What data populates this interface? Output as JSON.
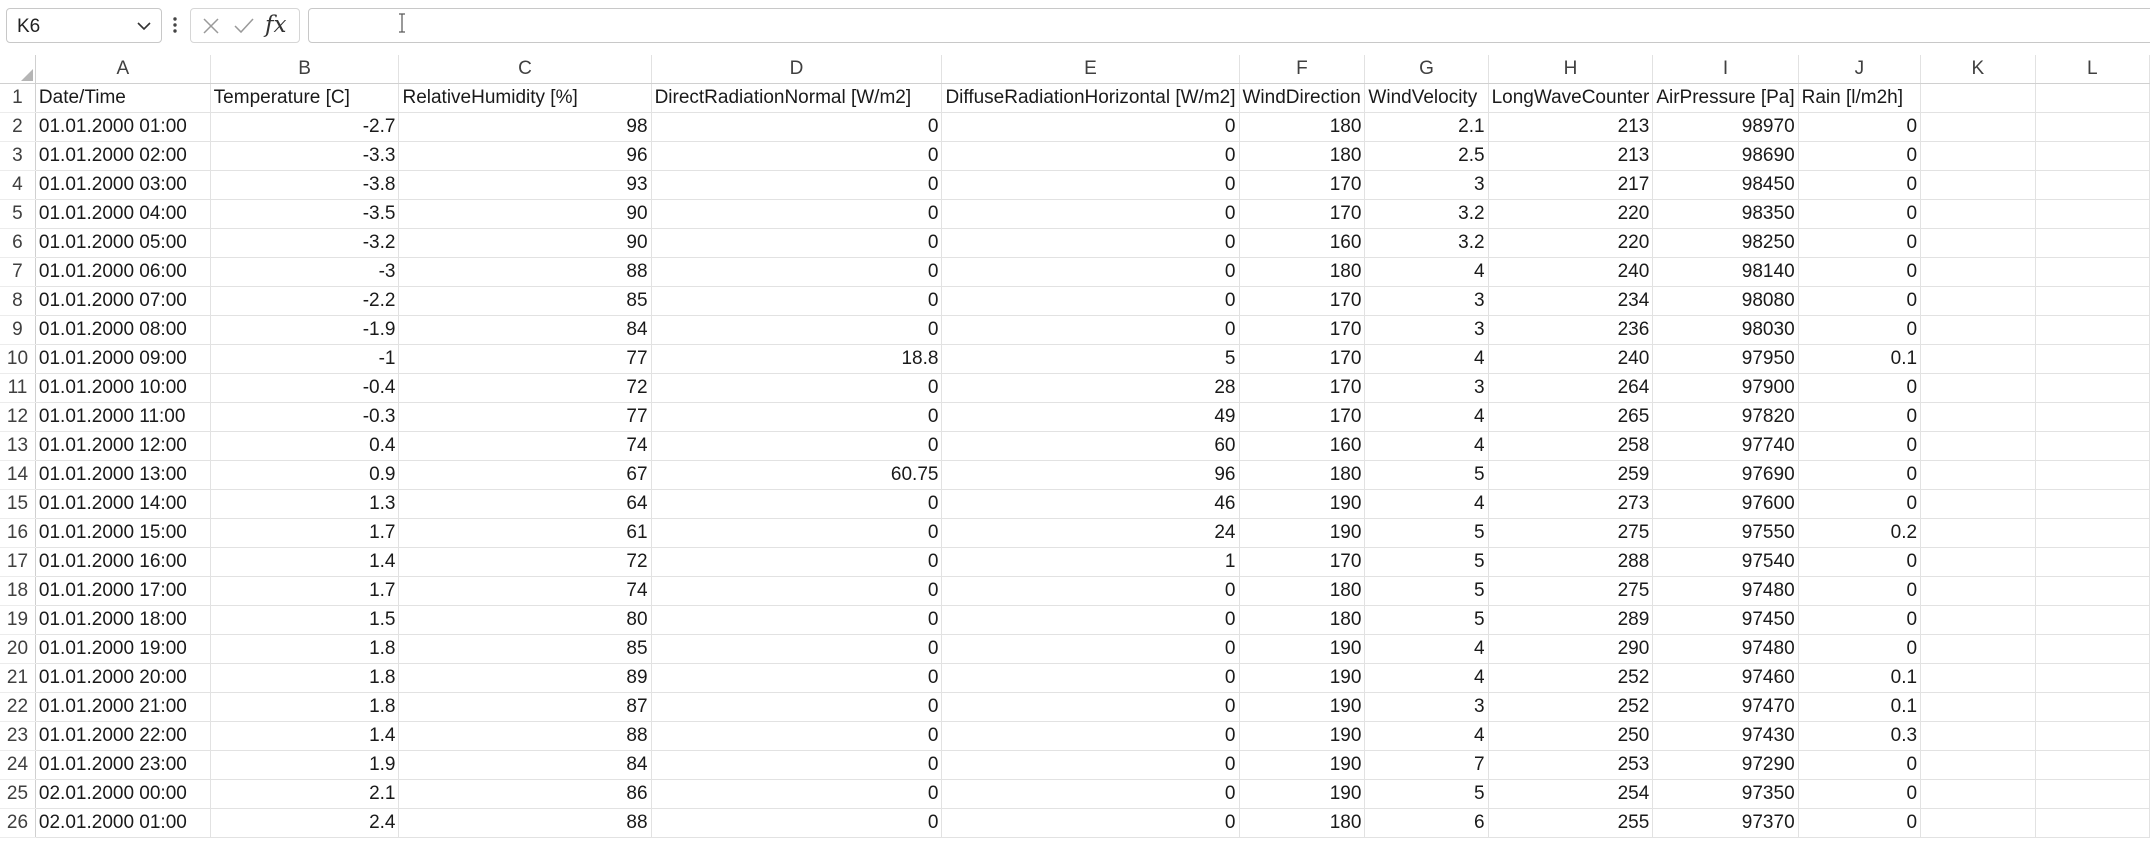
{
  "formula_bar": {
    "name_box": "K6",
    "formula_value": "",
    "fx_label": "fx"
  },
  "columns": [
    "A",
    "B",
    "C",
    "D",
    "E",
    "F",
    "G",
    "H",
    "I",
    "J",
    "K",
    "L"
  ],
  "headers": [
    "Date/Time",
    "Temperature [C]",
    "RelativeHumidity [%]",
    "DirectRadiationNormal [W/m2]",
    "DiffuseRadiationHorizontal [W/m2]",
    "WindDirection",
    "WindVelocity",
    "LongWaveCounter",
    "AirPressure [Pa]",
    "Rain [l/m2h]",
    "",
    ""
  ],
  "rows": [
    [
      "01.01.2000 01:00",
      "-2.7",
      "98",
      "0",
      "0",
      "180",
      "2.1",
      "213",
      "98970",
      "0"
    ],
    [
      "01.01.2000 02:00",
      "-3.3",
      "96",
      "0",
      "0",
      "180",
      "2.5",
      "213",
      "98690",
      "0"
    ],
    [
      "01.01.2000 03:00",
      "-3.8",
      "93",
      "0",
      "0",
      "170",
      "3",
      "217",
      "98450",
      "0"
    ],
    [
      "01.01.2000 04:00",
      "-3.5",
      "90",
      "0",
      "0",
      "170",
      "3.2",
      "220",
      "98350",
      "0"
    ],
    [
      "01.01.2000 05:00",
      "-3.2",
      "90",
      "0",
      "0",
      "160",
      "3.2",
      "220",
      "98250",
      "0"
    ],
    [
      "01.01.2000 06:00",
      "-3",
      "88",
      "0",
      "0",
      "180",
      "4",
      "240",
      "98140",
      "0"
    ],
    [
      "01.01.2000 07:00",
      "-2.2",
      "85",
      "0",
      "0",
      "170",
      "3",
      "234",
      "98080",
      "0"
    ],
    [
      "01.01.2000 08:00",
      "-1.9",
      "84",
      "0",
      "0",
      "170",
      "3",
      "236",
      "98030",
      "0"
    ],
    [
      "01.01.2000 09:00",
      "-1",
      "77",
      "18.8",
      "5",
      "170",
      "4",
      "240",
      "97950",
      "0.1"
    ],
    [
      "01.01.2000 10:00",
      "-0.4",
      "72",
      "0",
      "28",
      "170",
      "3",
      "264",
      "97900",
      "0"
    ],
    [
      "01.01.2000 11:00",
      "-0.3",
      "77",
      "0",
      "49",
      "170",
      "4",
      "265",
      "97820",
      "0"
    ],
    [
      "01.01.2000 12:00",
      "0.4",
      "74",
      "0",
      "60",
      "160",
      "4",
      "258",
      "97740",
      "0"
    ],
    [
      "01.01.2000 13:00",
      "0.9",
      "67",
      "60.75",
      "96",
      "180",
      "5",
      "259",
      "97690",
      "0"
    ],
    [
      "01.01.2000 14:00",
      "1.3",
      "64",
      "0",
      "46",
      "190",
      "4",
      "273",
      "97600",
      "0"
    ],
    [
      "01.01.2000 15:00",
      "1.7",
      "61",
      "0",
      "24",
      "190",
      "5",
      "275",
      "97550",
      "0.2"
    ],
    [
      "01.01.2000 16:00",
      "1.4",
      "72",
      "0",
      "1",
      "170",
      "5",
      "288",
      "97540",
      "0"
    ],
    [
      "01.01.2000 17:00",
      "1.7",
      "74",
      "0",
      "0",
      "180",
      "5",
      "275",
      "97480",
      "0"
    ],
    [
      "01.01.2000 18:00",
      "1.5",
      "80",
      "0",
      "0",
      "180",
      "5",
      "289",
      "97450",
      "0"
    ],
    [
      "01.01.2000 19:00",
      "1.8",
      "85",
      "0",
      "0",
      "190",
      "4",
      "290",
      "97480",
      "0"
    ],
    [
      "01.01.2000 20:00",
      "1.8",
      "89",
      "0",
      "0",
      "190",
      "4",
      "252",
      "97460",
      "0.1"
    ],
    [
      "01.01.2000 21:00",
      "1.8",
      "87",
      "0",
      "0",
      "190",
      "3",
      "252",
      "97470",
      "0.1"
    ],
    [
      "01.01.2000 22:00",
      "1.4",
      "88",
      "0",
      "0",
      "190",
      "4",
      "250",
      "97430",
      "0.3"
    ],
    [
      "01.01.2000 23:00",
      "1.9",
      "84",
      "0",
      "0",
      "190",
      "7",
      "253",
      "97290",
      "0"
    ],
    [
      "02.01.2000 00:00",
      "2.1",
      "86",
      "0",
      "0",
      "190",
      "5",
      "254",
      "97350",
      "0"
    ],
    [
      "02.01.2000 01:00",
      "2.4",
      "88",
      "0",
      "0",
      "180",
      "6",
      "255",
      "97370",
      "0"
    ]
  ],
  "icons": {
    "name_box_dropdown": "chevron-down-icon",
    "more": "vertical-dots-icon",
    "cancel": "x-icon",
    "enter": "checkmark-icon",
    "cursor": "text-cursor-icon"
  }
}
